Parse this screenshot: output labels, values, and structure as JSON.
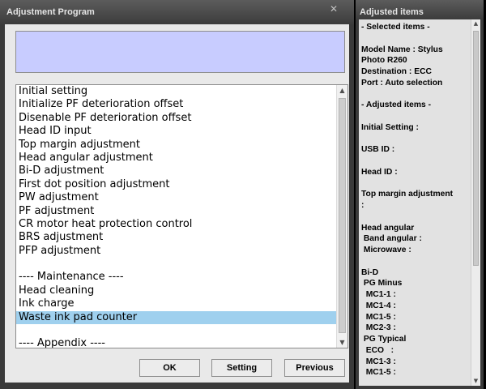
{
  "left_window": {
    "title": "Adjustment Program",
    "close_glyph": "✕",
    "info_text": "",
    "list_items": [
      "Initial setting",
      "Initialize PF deterioration offset",
      "Disenable PF deterioration offset",
      "Head ID input",
      "Top margin adjustment",
      "Head angular adjustment",
      "Bi-D adjustment",
      "First dot position adjustment",
      "PW adjustment",
      "PF adjustment",
      "CR motor heat protection control",
      "BRS adjustment",
      "PFP adjustment",
      "",
      "---- Maintenance ----",
      "Head cleaning",
      "Ink charge",
      "Waste ink pad counter",
      "",
      "---- Appendix ----"
    ],
    "selected_item": "Waste ink pad counter",
    "buttons": {
      "ok": "OK",
      "setting": "Setting",
      "previous": "Previous"
    }
  },
  "right_window": {
    "title": "Adjusted items",
    "lines": [
      "- Selected items -",
      "",
      "Model Name : Stylus",
      "Photo R260",
      "Destination : ECC",
      "Port : Auto selection",
      "",
      "- Adjusted items -",
      "",
      "Initial Setting :",
      "",
      "USB ID :",
      "",
      "Head ID :",
      "",
      "Top margin adjustment",
      ":",
      "",
      "Head angular",
      " Band angular :",
      " Microwave :",
      "",
      "Bi-D",
      " PG Minus",
      "  MC1-1 :",
      "  MC1-4 :",
      "  MC1-5 :",
      "  MC2-3 :",
      " PG Typical",
      "  ECO   :",
      "  MC1-3 :",
      "  MC1-5 :"
    ]
  },
  "colors": {
    "selection": "#9fd0ee",
    "info_box": "#c8ccff",
    "window_frame": "#3a3a3a",
    "client_bg": "#e9e9e9"
  },
  "icons": {
    "scroll_up": "▲",
    "scroll_down": "▼"
  }
}
